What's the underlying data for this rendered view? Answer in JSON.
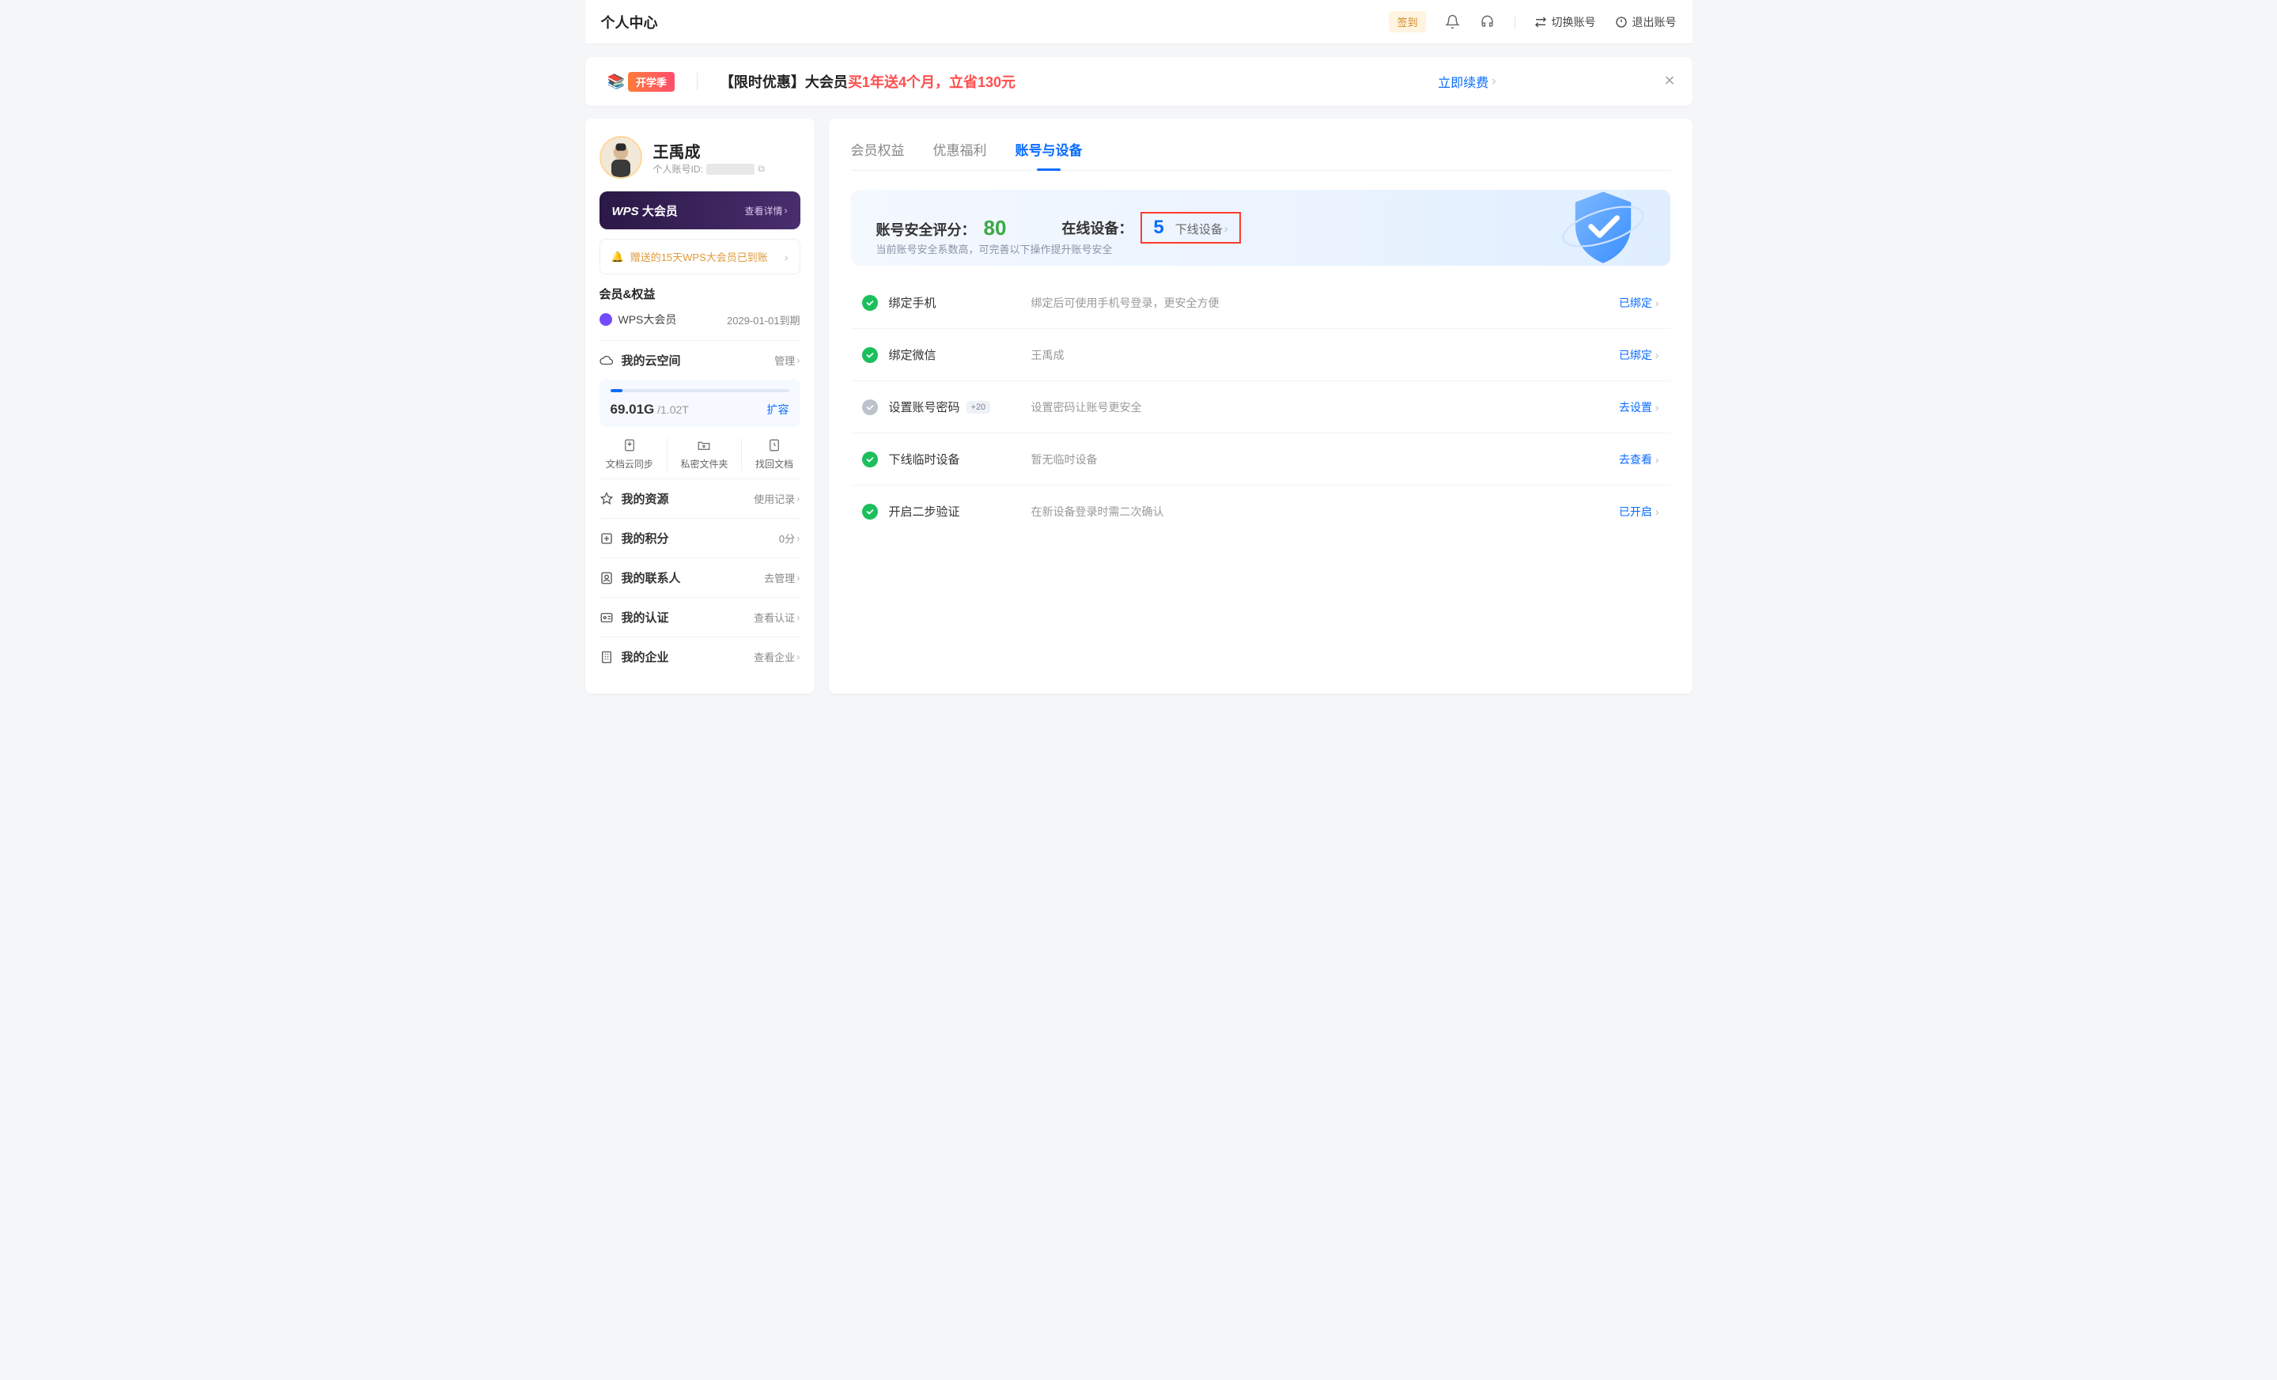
{
  "header": {
    "title": "个人中心",
    "signin": "签到",
    "switch_account": "切换账号",
    "logout": "退出账号"
  },
  "promo": {
    "badge": "开学季",
    "text_prefix": "【限时优惠】大会员",
    "text_highlight": "买1年送4个月，立省130元",
    "renew": "立即续费"
  },
  "profile": {
    "name": "王禹成",
    "id_label": "个人账号ID:"
  },
  "vip": {
    "logo": "WPS",
    "logo_tail": "大会员",
    "detail": "查看详情"
  },
  "gift": {
    "text": "赠送的15天WPS大会员已到账"
  },
  "membership": {
    "title": "会员&权益",
    "name": "WPS大会员",
    "expire": "2029-01-01到期"
  },
  "cloud": {
    "title": "我的云空间",
    "manage": "管理",
    "used": "69.01G",
    "total": "/1.02T",
    "expand": "扩容"
  },
  "tools": {
    "sync": "文档云同步",
    "private": "私密文件夹",
    "recover": "找回文档"
  },
  "side": {
    "resources": {
      "label": "我的资源",
      "action": "使用记录"
    },
    "points": {
      "label": "我的积分",
      "action": "0分"
    },
    "contacts": {
      "label": "我的联系人",
      "action": "去管理"
    },
    "cert": {
      "label": "我的认证",
      "action": "查看认证"
    },
    "enterprise": {
      "label": "我的企业",
      "action": "查看企业"
    }
  },
  "tabs": {
    "benefits": "会员权益",
    "welfare": "优惠福利",
    "account": "账号与设备"
  },
  "score": {
    "label": "账号安全评分：",
    "value": "80",
    "devices_label": "在线设备：",
    "devices_count": "5",
    "offline_action": "下线设备",
    "hint": "当前账号安全系数高，可完善以下操作提升账号安全"
  },
  "security": [
    {
      "status": "ok",
      "title": "绑定手机",
      "badge": "",
      "desc": "绑定后可使用手机号登录，更安全方便",
      "action": "已绑定"
    },
    {
      "status": "ok",
      "title": "绑定微信",
      "badge": "",
      "desc": "王禹成",
      "action": "已绑定"
    },
    {
      "status": "warn",
      "title": "设置账号密码",
      "badge": "+20",
      "desc": "设置密码让账号更安全",
      "action": "去设置"
    },
    {
      "status": "ok",
      "title": "下线临时设备",
      "badge": "",
      "desc": "暂无临时设备",
      "action": "去查看"
    },
    {
      "status": "ok",
      "title": "开启二步验证",
      "badge": "",
      "desc": "在新设备登录时需二次确认",
      "action": "已开启"
    }
  ]
}
